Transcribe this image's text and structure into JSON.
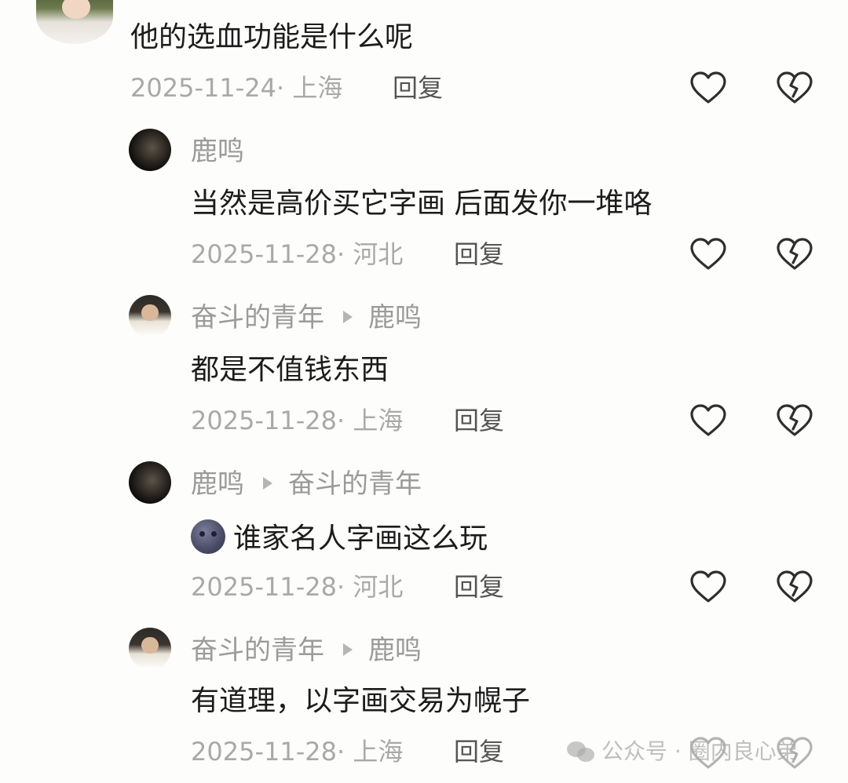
{
  "comments": [
    {
      "content": "他的选血功能是什么呢",
      "date": "2025-11-24",
      "location": "上海",
      "reply_label": "回复"
    },
    {
      "user": "鹿鸣",
      "content": "当然是高价买它字画 后面发你一堆咯",
      "date": "2025-11-28",
      "location": "河北",
      "reply_label": "回复"
    },
    {
      "user": "奋斗的青年",
      "reply_to": "鹿鸣",
      "content": "都是不值钱东西",
      "date": "2025-11-28",
      "location": "上海",
      "reply_label": "回复"
    },
    {
      "user": "鹿鸣",
      "reply_to": "奋斗的青年",
      "emoji": "new-moon-face",
      "content": "谁家名人字画这么玩",
      "date": "2025-11-28",
      "location": "河北",
      "reply_label": "回复"
    },
    {
      "user": "奋斗的青年",
      "reply_to": "鹿鸣",
      "content": "有道理，以字画交易为幌子",
      "date": "2025-11-28",
      "location": "上海",
      "reply_label": "回复"
    }
  ],
  "meta_separator": "· ",
  "watermark": {
    "text": "公众号 · 圈内良心弟",
    "icon": "wechat-icon"
  },
  "colors": {
    "background": "#fdfdfb",
    "text": "#1c1c1c",
    "muted": "#a9a9a9",
    "username": "#9b9b9b"
  }
}
